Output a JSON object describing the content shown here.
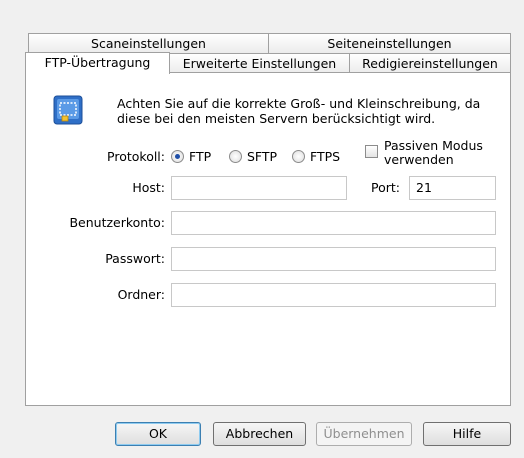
{
  "tabs": {
    "row1": [
      "Scaneinstellungen",
      "Seiteneinstellungen"
    ],
    "row2": [
      "FTP-Übertragung",
      "Erweiterte Einstellungen",
      "Redigiereinstellungen"
    ],
    "active": "FTP-Übertragung"
  },
  "info": {
    "icon": "ftp-info-icon",
    "text": "Achten Sie auf die korrekte Groß- und Kleinschreibung, da diese bei den meisten Servern berücksichtigt wird."
  },
  "protocol": {
    "label": "Protokoll:",
    "options": [
      "FTP",
      "SFTP",
      "FTPS"
    ],
    "selected": "FTP",
    "passive_label": "Passiven Modus verwenden",
    "passive_checked": false
  },
  "fields": {
    "host_label": "Host:",
    "host_value": "",
    "port_label": "Port:",
    "port_value": "21",
    "account_label": "Benutzerkonto:",
    "account_value": "",
    "password_label": "Passwort:",
    "password_value": "",
    "folder_label": "Ordner:",
    "folder_value": ""
  },
  "buttons": {
    "ok": "OK",
    "cancel": "Abbrechen",
    "apply": "Übernehmen",
    "apply_enabled": false,
    "help": "Hilfe"
  }
}
